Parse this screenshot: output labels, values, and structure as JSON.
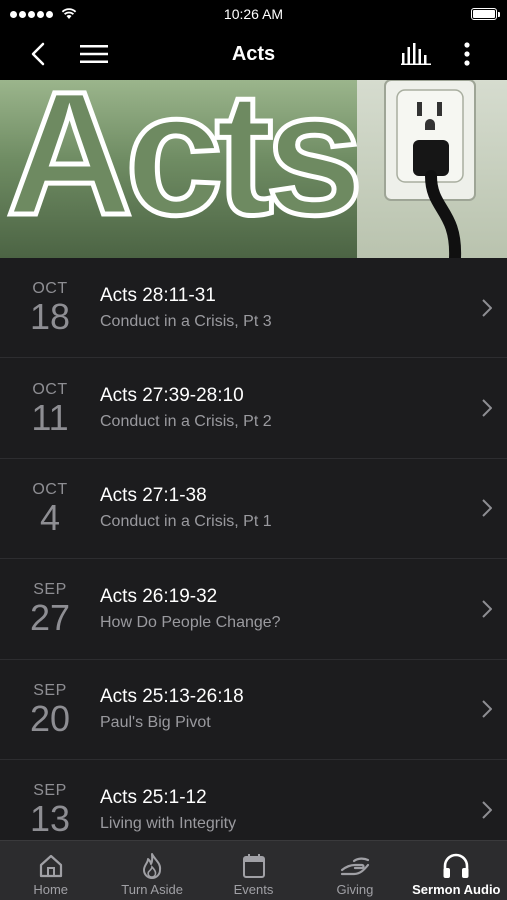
{
  "status": {
    "time": "10:26 AM"
  },
  "nav": {
    "title": "Acts"
  },
  "hero": {
    "title": "Acts"
  },
  "sermons": [
    {
      "month": "OCT",
      "day": "18",
      "title": "Acts 28:11-31",
      "subtitle": "Conduct in a Crisis, Pt 3"
    },
    {
      "month": "OCT",
      "day": "11",
      "title": "Acts 27:39-28:10",
      "subtitle": "Conduct in a Crisis, Pt 2"
    },
    {
      "month": "OCT",
      "day": "4",
      "title": "Acts 27:1-38",
      "subtitle": "Conduct in a Crisis, Pt 1"
    },
    {
      "month": "SEP",
      "day": "27",
      "title": "Acts 26:19-32",
      "subtitle": "How Do People Change?"
    },
    {
      "month": "SEP",
      "day": "20",
      "title": "Acts 25:13-26:18",
      "subtitle": "Paul's Big Pivot"
    },
    {
      "month": "SEP",
      "day": "13",
      "title": "Acts 25:1-12",
      "subtitle": "Living with Integrity"
    }
  ],
  "tabs": [
    {
      "label": "Home",
      "icon": "home-icon"
    },
    {
      "label": "Turn Aside",
      "icon": "flame-icon"
    },
    {
      "label": "Events",
      "icon": "calendar-icon"
    },
    {
      "label": "Giving",
      "icon": "giving-hand-icon"
    },
    {
      "label": "Sermon Audio",
      "icon": "headphones-icon",
      "active": true
    }
  ],
  "colors": {
    "background": "#1c1c1e",
    "bar": "#000000",
    "tab_bar": "#2c2c2e",
    "hero_green": "#6e8a61"
  }
}
